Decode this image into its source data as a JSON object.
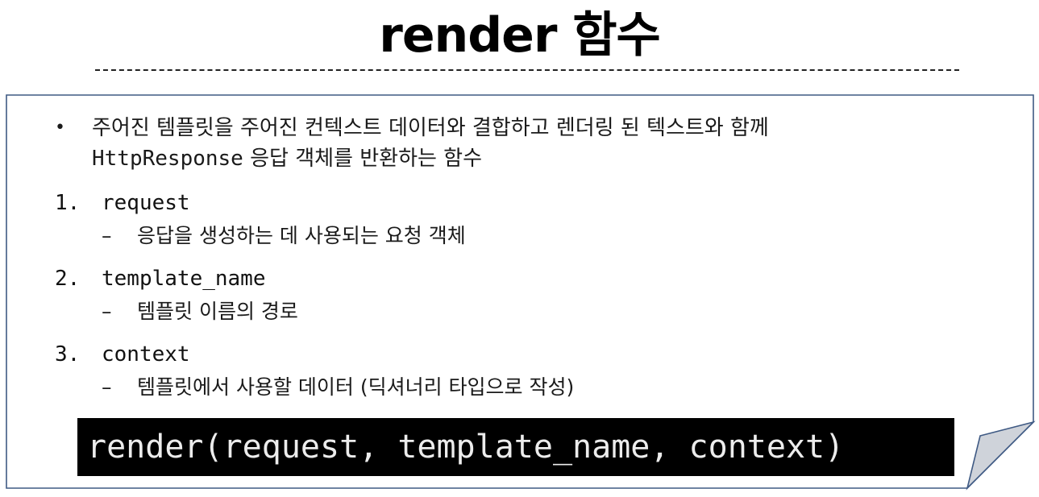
{
  "title": "render 함수",
  "intro": {
    "line1": "주어진 템플릿을 주어진 컨텍스트 데이터와 결합하고 렌더링 된 텍스트와 함께",
    "line2_code": "HttpResponse",
    "line2_rest": " 응답 객체를 반환하는 함수"
  },
  "params": [
    {
      "number": "1.",
      "name": "request",
      "description": "응답을 생성하는 데 사용되는 요청 객체"
    },
    {
      "number": "2.",
      "name": "template_name",
      "description": "템플릿 이름의 경로"
    },
    {
      "number": "3.",
      "name": "context",
      "description": "템플릿에서 사용할 데이터 (딕셔너리 타입으로 작성)"
    }
  ],
  "code": "render(request, template_name, context)",
  "colors": {
    "box_border": "#3f5a84",
    "code_bg": "#000000",
    "code_fg": "#ececec",
    "fold_fill": "#cfd3da"
  }
}
